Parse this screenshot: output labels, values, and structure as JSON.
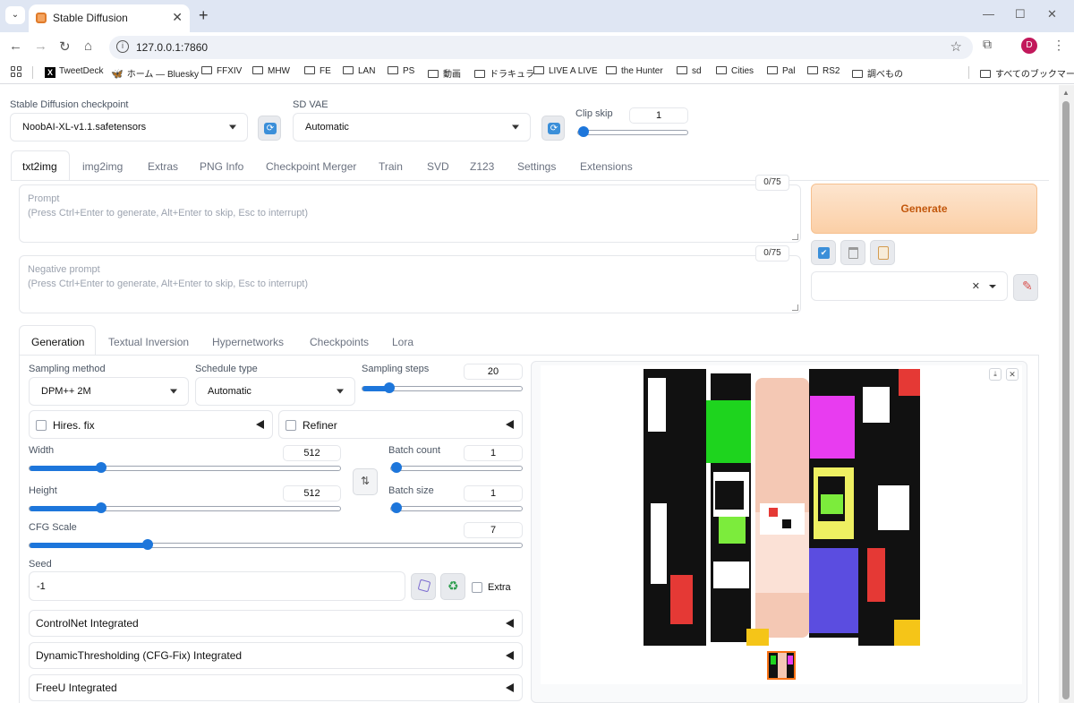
{
  "browser": {
    "tab_title": "Stable Diffusion",
    "url": "127.0.0.1:7860",
    "avatar_letter": "D",
    "bookmarks": [
      "TweetDeck",
      "ホーム — Bluesky",
      "FFXIV",
      "MHW",
      "FE",
      "LAN",
      "PS",
      "動画",
      "ドラキュラ",
      "LIVE A LIVE",
      "the Hunter",
      "sd",
      "Cities",
      "Pal",
      "RS2",
      "調べもの"
    ],
    "all_bookmarks": "すべてのブックマーク"
  },
  "top": {
    "checkpoint_label": "Stable Diffusion checkpoint",
    "checkpoint_value": "NoobAI-XL-v1.1.safetensors",
    "vae_label": "SD VAE",
    "vae_value": "Automatic",
    "clip_label": "Clip skip",
    "clip_value": "1",
    "clip_fraction": 0.0
  },
  "main_tabs": [
    "txt2img",
    "img2img",
    "Extras",
    "PNG Info",
    "Checkpoint Merger",
    "Train",
    "SVD",
    "Z123",
    "Settings",
    "Extensions"
  ],
  "prompt": {
    "label": "Prompt",
    "hint": "(Press Ctrl+Enter to generate, Alt+Enter to skip, Esc to interrupt)",
    "counter": "0/75"
  },
  "negative": {
    "label": "Negative prompt",
    "hint": "(Press Ctrl+Enter to generate, Alt+Enter to skip, Esc to interrupt)",
    "counter": "0/75"
  },
  "generate_label": "Generate",
  "sub_tabs": [
    "Generation",
    "Textual Inversion",
    "Hypernetworks",
    "Checkpoints",
    "Lora"
  ],
  "gen": {
    "sampling_method_label": "Sampling method",
    "sampling_method_value": "DPM++ 2M",
    "schedule_label": "Schedule type",
    "schedule_value": "Automatic",
    "steps_label": "Sampling steps",
    "steps_value": "20",
    "steps_fraction": 0.17,
    "hires_label": "Hires. fix",
    "refiner_label": "Refiner",
    "width_label": "Width",
    "width_value": "512",
    "width_fraction": 0.23,
    "height_label": "Height",
    "height_value": "512",
    "height_fraction": 0.23,
    "batch_count_label": "Batch count",
    "batch_count_value": "1",
    "batch_count_fraction": 0.0,
    "batch_size_label": "Batch size",
    "batch_size_value": "1",
    "batch_size_fraction": 0.0,
    "cfg_label": "CFG Scale",
    "cfg_value": "7",
    "cfg_fraction": 0.24,
    "seed_label": "Seed",
    "seed_value": "-1",
    "extra_label": "Extra",
    "swap_glyph": "⇅"
  },
  "accordions": [
    "ControlNet Integrated",
    "DynamicThresholding (CFG-Fix) Integrated",
    "FreeU Integrated"
  ],
  "colors": {
    "accent": "#1d76db",
    "generate_bg": "#fbd4b0",
    "generate_text": "#c2570c"
  }
}
